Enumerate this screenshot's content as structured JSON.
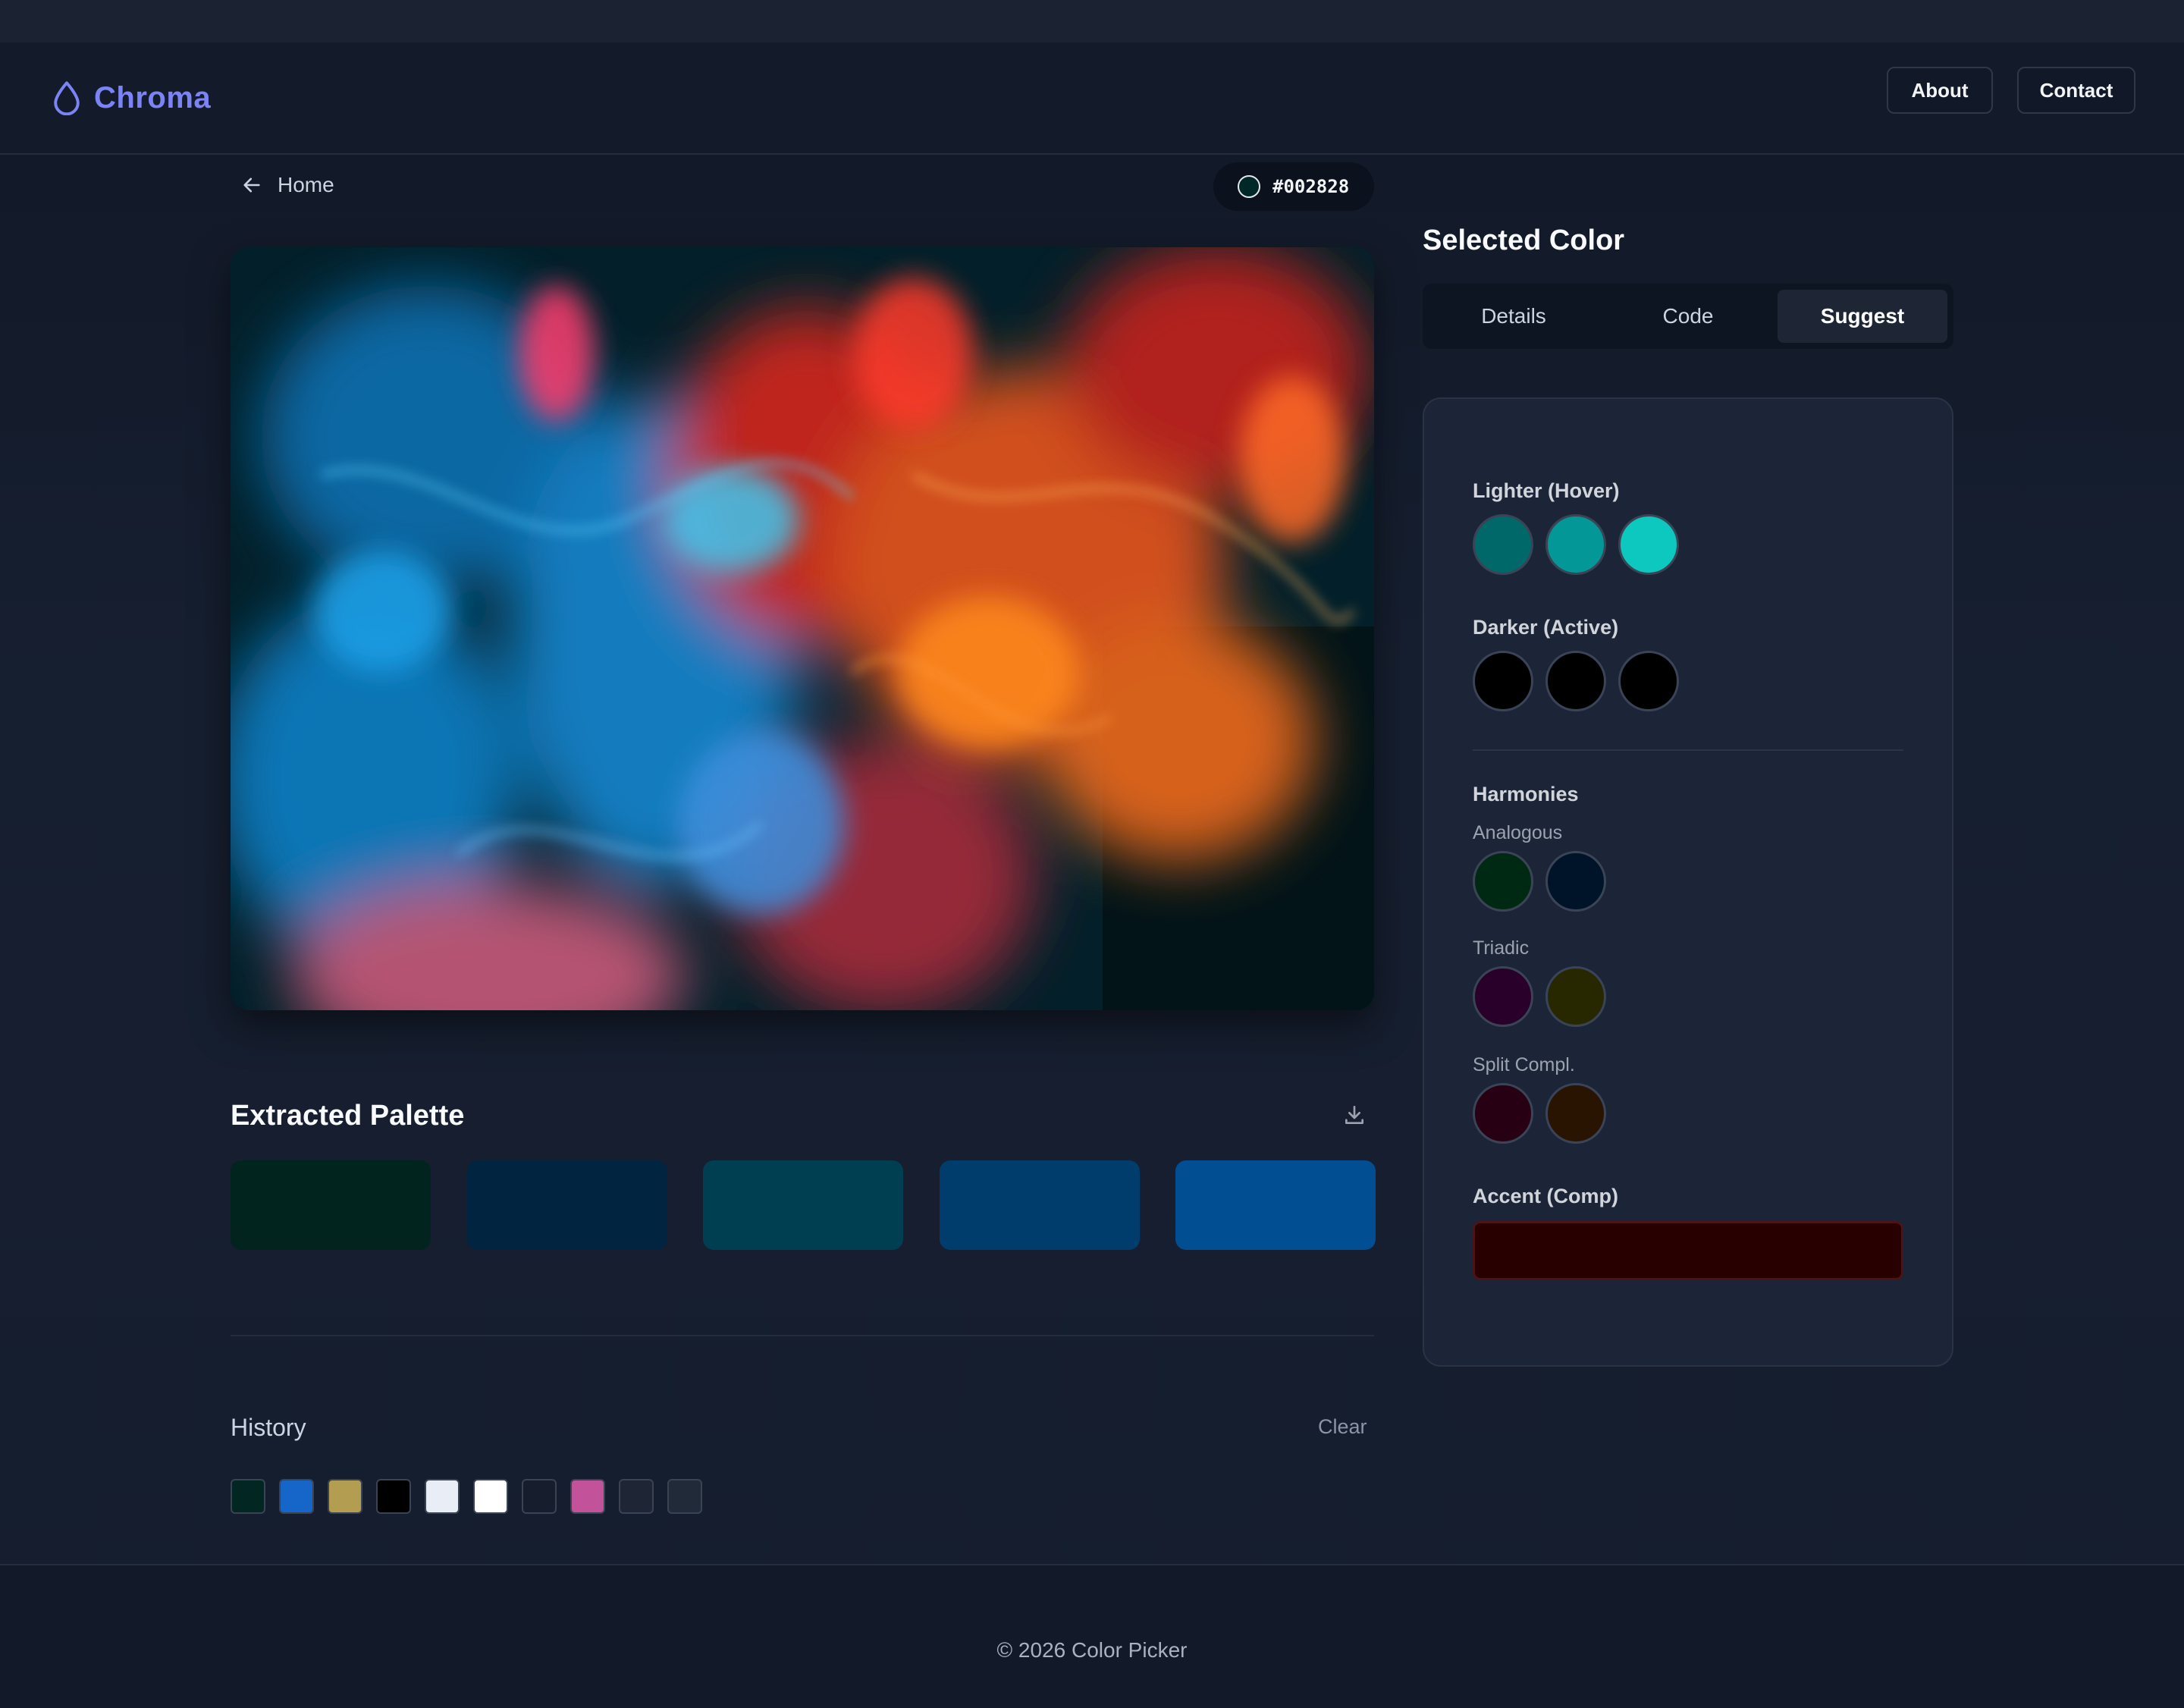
{
  "app": {
    "brand": "Chroma",
    "nav": [
      "About",
      "Contact"
    ]
  },
  "breadcrumb": {
    "back_label": "Home"
  },
  "current_color": {
    "hex": "#002828"
  },
  "palette": {
    "title": "Extracted Palette",
    "swatches": [
      "#01241f",
      "#012540",
      "#003f52",
      "#003c6c",
      "#014f92"
    ]
  },
  "history": {
    "title": "History",
    "clear_label": "Clear",
    "colors": [
      "#022622",
      "#1665c8",
      "#b39d50",
      "#000000",
      "#e9edf5",
      "#ffffff",
      "#161e2e",
      "#c25299",
      "#1e2636",
      "#212a39"
    ]
  },
  "selected": {
    "title": "Selected Color",
    "tabs": [
      "Details",
      "Code",
      "Suggest"
    ],
    "active_tab": "Suggest",
    "lighter_label": "Lighter (Hover)",
    "lighter": [
      "#006868",
      "#039797",
      "#0dc8bf"
    ],
    "darker_label": "Darker (Active)",
    "darker": [
      "#000000",
      "#000000",
      "#000000"
    ],
    "harmonies_label": "Harmonies",
    "analogous_label": "Analogous",
    "analogous": [
      "#002914",
      "#001429"
    ],
    "triadic_label": "Triadic",
    "triadic": [
      "#290029",
      "#282800"
    ],
    "split_label": "Split Compl.",
    "split": [
      "#280014",
      "#281400"
    ],
    "accent_label": "Accent (Comp)",
    "accent": "#280000"
  },
  "footer": {
    "copyright": "© 2026 Color Picker"
  },
  "colors": {
    "brand": "#7c83f5",
    "background": "#111827"
  },
  "icons": [
    "droplet-icon",
    "arrow-left-icon",
    "download-icon"
  ]
}
